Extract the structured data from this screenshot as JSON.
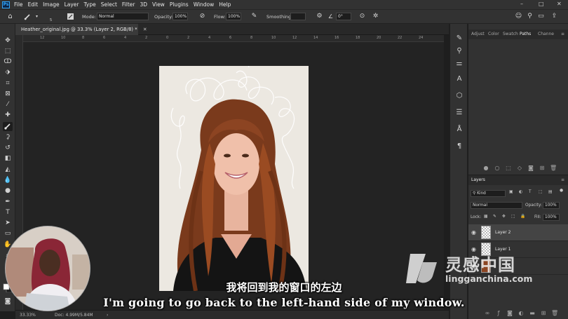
{
  "menubar": {
    "items": [
      "File",
      "Edit",
      "Image",
      "Layer",
      "Type",
      "Select",
      "Filter",
      "3D",
      "View",
      "Plugins",
      "Window",
      "Help"
    ]
  },
  "options": {
    "mode_label": "Mode:",
    "mode_value": "Normal",
    "opacity_label": "Opacity:",
    "opacity_value": "100%",
    "flow_label": "Flow:",
    "flow_value": "100%",
    "smoothing_label": "Smoothing:",
    "angle_value": "0°",
    "brush_size": "5"
  },
  "document": {
    "tab_title": "Heather_original.jpg @ 33.3% (Layer 2, RGB/8) *",
    "ruler_marks": [
      "12",
      "10",
      "8",
      "6",
      "4",
      "2",
      "0",
      "2",
      "4",
      "6",
      "8",
      "10",
      "12",
      "14",
      "16",
      "18",
      "20",
      "22",
      "24"
    ]
  },
  "status": {
    "zoom": "33.33%",
    "doc": "Doc: 4.99M/5.84M"
  },
  "panel_tabs": [
    "Adjust",
    "Color",
    "Swatch",
    "Paths",
    "Channe"
  ],
  "layers": {
    "title": "Layers",
    "kind": "Kind",
    "blend": "Normal",
    "opacity_label": "Opacity:",
    "opacity_value": "100%",
    "lock_label": "Lock:",
    "fill_label": "Fill:",
    "fill_value": "100%",
    "rows": [
      {
        "name": "Layer 2"
      },
      {
        "name": "Layer 1"
      }
    ]
  },
  "subtitle": {
    "cn": "我将回到我的窗口的左边",
    "en": "I'm going to go back to the left-hand side of my window."
  },
  "watermark": {
    "cn": "灵感中国",
    "en": "lingganchina.com"
  }
}
